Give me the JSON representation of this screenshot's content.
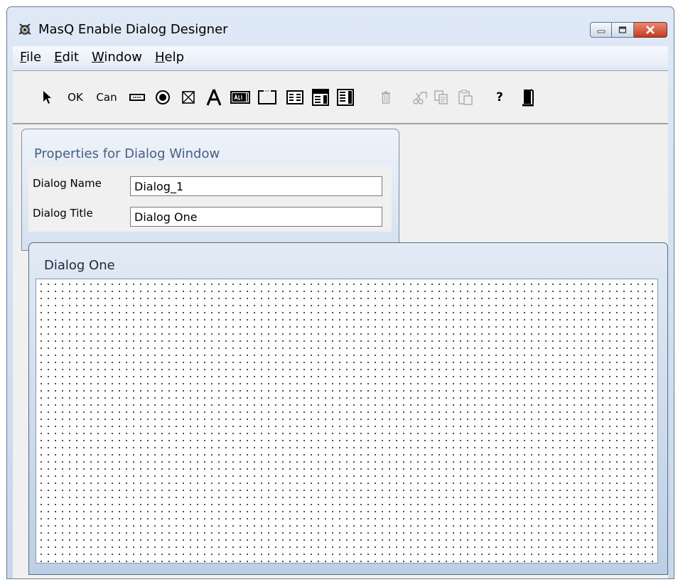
{
  "window": {
    "title": "MasQ Enable Dialog Designer"
  },
  "menu": [
    "File",
    "Edit",
    "Window",
    "Help"
  ],
  "toolbar": {
    "ok_label": "OK",
    "cancel_label": "Can",
    "help_label": "?"
  },
  "properties": {
    "title": "Properties for Dialog Window",
    "name_label": "Dialog Name",
    "name_value": "Dialog_1",
    "title_label": "Dialog Title",
    "title_value": "Dialog One"
  },
  "dialog": {
    "title": "Dialog One"
  }
}
